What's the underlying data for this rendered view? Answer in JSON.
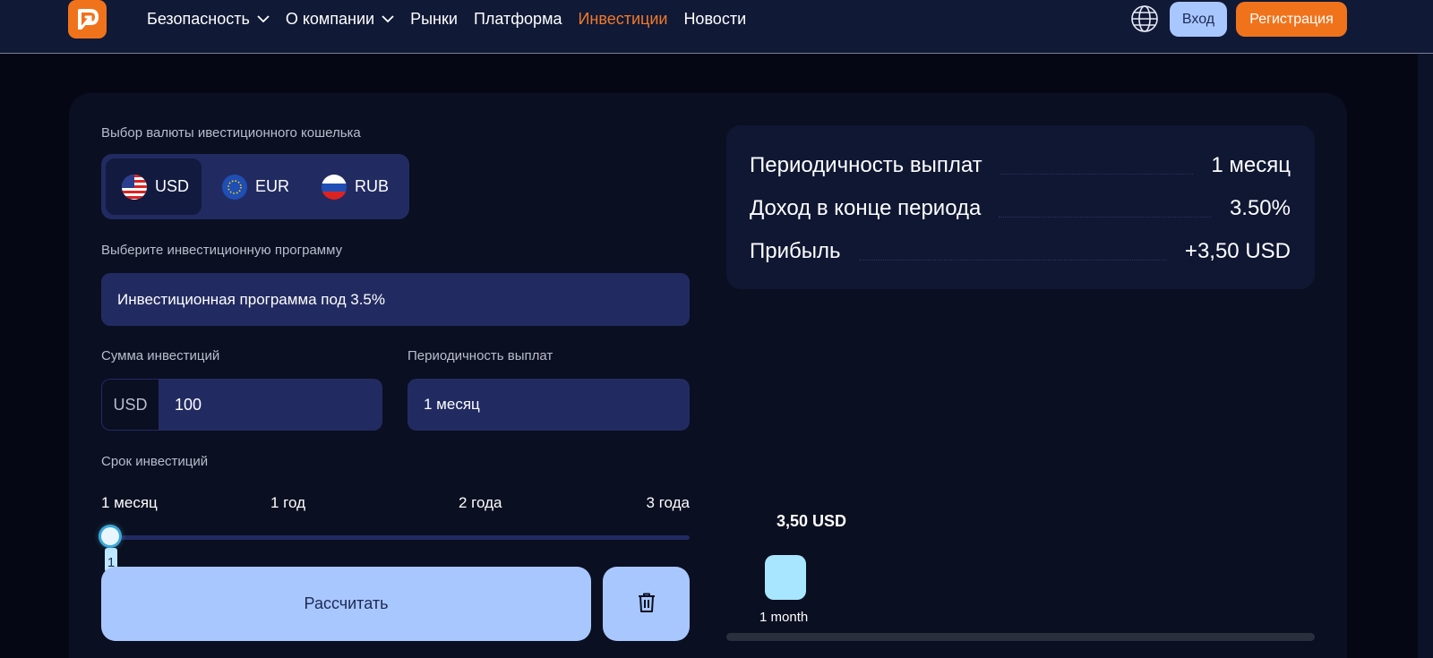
{
  "header": {
    "nav": [
      {
        "label": "Безопасность",
        "has_dropdown": true,
        "active": false
      },
      {
        "label": "О компании",
        "has_dropdown": true,
        "active": false
      },
      {
        "label": "Рынки",
        "has_dropdown": false,
        "active": false
      },
      {
        "label": "Платформа",
        "has_dropdown": false,
        "active": false
      },
      {
        "label": "Инвестиции",
        "has_dropdown": false,
        "active": true
      },
      {
        "label": "Новости",
        "has_dropdown": false,
        "active": false
      }
    ],
    "login_label": "Вход",
    "register_label": "Регистрация",
    "icons": {
      "logo": "brand-logo-icon",
      "language": "globe-icon"
    }
  },
  "form": {
    "currency_label": "Выбор валюты ивестиционного кошелька",
    "currencies": [
      {
        "code": "USD",
        "icon": "us-flag-icon",
        "selected": true
      },
      {
        "code": "EUR",
        "icon": "eu-flag-icon",
        "selected": false
      },
      {
        "code": "RUB",
        "icon": "ru-flag-icon",
        "selected": false
      }
    ],
    "program_label": "Выберите инвестиционную программу",
    "program_value": "Инвестиционная программа под 3.5%",
    "amount_label": "Сумма инвестиций",
    "amount_prefix": "USD",
    "amount_value": "100",
    "period_label": "Периодичность выплат",
    "period_value": "1 месяц",
    "term_label": "Срок инвестиций",
    "term_marks": [
      "1 месяц",
      "1 год",
      "2 года",
      "3 года"
    ],
    "term_slider_value": "1",
    "calculate_label": "Рассчитать",
    "clear_icon": "trash-icon"
  },
  "summary": {
    "rows": [
      {
        "label": "Периодичность выплат",
        "value": "1 месяц"
      },
      {
        "label": "Доход в конце периода",
        "value": "3.50%"
      },
      {
        "label": "Прибыль",
        "value": "+3,50 USD"
      }
    ]
  },
  "chart_data": {
    "type": "bar",
    "categories": [
      "1 month"
    ],
    "values": [
      3.5
    ],
    "data_labels": [
      "3,50 USD"
    ]
  },
  "colors": {
    "accent": "#f0731c",
    "button_light": "#a9c7ff",
    "panel": "#222b61",
    "bar": "#a8e6ff"
  }
}
